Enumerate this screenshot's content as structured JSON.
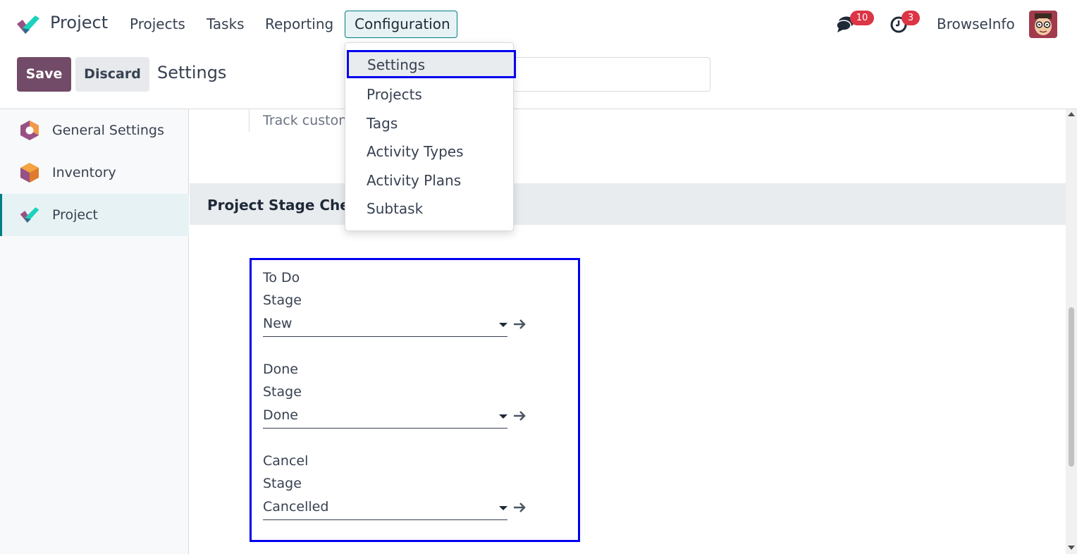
{
  "navbar": {
    "app_name": "Project",
    "menu": [
      "Projects",
      "Tasks",
      "Reporting",
      "Configuration"
    ],
    "messages_count": "10",
    "activities_count": "3",
    "user_name": "BrowseInfo"
  },
  "control_panel": {
    "save_label": "Save",
    "discard_label": "Discard",
    "breadcrumb": "Settings"
  },
  "sidebar": {
    "items": [
      {
        "label": "General Settings",
        "icon": "general-settings-icon"
      },
      {
        "label": "Inventory",
        "icon": "inventory-icon"
      },
      {
        "label": "Project",
        "icon": "project-icon",
        "active": true
      }
    ]
  },
  "content": {
    "track_text": "Track custon",
    "section_title": "Project Stage Chec",
    "fields": [
      {
        "title": "To Do",
        "label": "Stage",
        "value": "New"
      },
      {
        "title": "Done",
        "label": "Stage",
        "value": "Done"
      },
      {
        "title": "Cancel",
        "label": "Stage",
        "value": "Cancelled"
      }
    ]
  },
  "dropdown": {
    "items": [
      "Settings",
      "Projects",
      "Tags",
      "Activity Types",
      "Activity Plans",
      "Subtask"
    ],
    "selected": "Settings"
  },
  "colors": {
    "brand": "#714b67",
    "accent": "#017e84",
    "badge": "#dc3545",
    "highlight": "#0000ee"
  }
}
